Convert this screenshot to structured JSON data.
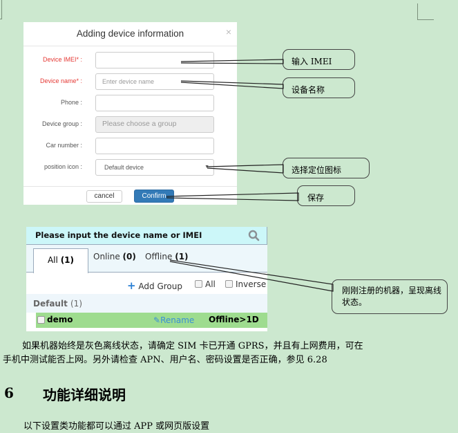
{
  "dialog": {
    "title": "Adding device information",
    "close_icon": "×",
    "fields": [
      {
        "label": "Device IMEI* :",
        "required": true,
        "value": "",
        "placeholder": ""
      },
      {
        "label": "Device name* :",
        "required": true,
        "value": "",
        "placeholder": "Enter device name"
      },
      {
        "label": "Phone :",
        "required": false,
        "value": "",
        "placeholder": ""
      },
      {
        "label": "Device group :",
        "required": false,
        "value": "",
        "placeholder": "Please choose a group",
        "disabled": true
      },
      {
        "label": "Car number :",
        "required": false,
        "value": "",
        "placeholder": ""
      },
      {
        "label": "position icon :",
        "required": false,
        "value": "Default device",
        "type": "select"
      }
    ],
    "select_arrow": "▼",
    "cancel_label": "cancel",
    "confirm_label": "Confirm"
  },
  "callouts": {
    "imei": "输入 IMEI",
    "name": "设备名称",
    "icon": "选择定位图标",
    "save": "保存",
    "offline": "刚刚注册的机器，呈现离线状态。"
  },
  "device_list": {
    "search_placeholder": "Please input the device name or IMEI",
    "tabs": [
      {
        "label": "All",
        "count": "(1)"
      },
      {
        "label": "Online",
        "count": "(0)"
      },
      {
        "label": "Offline",
        "count": "(1)"
      }
    ],
    "add_group_icon": "+",
    "add_group_label": "Add Group",
    "select_all_label": "All",
    "inverse_label": "Inverse",
    "group": {
      "name": "Default",
      "count": "(1)"
    },
    "devices": [
      {
        "name": "demo",
        "rename_label": "Rename",
        "status": "Offline>1D"
      }
    ]
  },
  "colors": {
    "page_bg": "#cce8cf",
    "required_label": "#e53935",
    "confirm_bg": "#337ab7",
    "search_bg": "#ccf7f9",
    "device_row_bg": "#9edc8f",
    "rename_link": "#3a8fd6"
  },
  "document": {
    "para1_line1": "如果机器始终是灰色离线状态，请确定 SIM 卡已开通 GPRS，并且有上网费用，可在",
    "para1_line2": "手机中测试能否上网。另外请检查 APN、用户名、密码设置是否正确，参见 6.28",
    "section_number": "6",
    "section_title": "功能详细说明",
    "para2": "以下设置类功能都可以通过 APP 或网页版设置"
  }
}
